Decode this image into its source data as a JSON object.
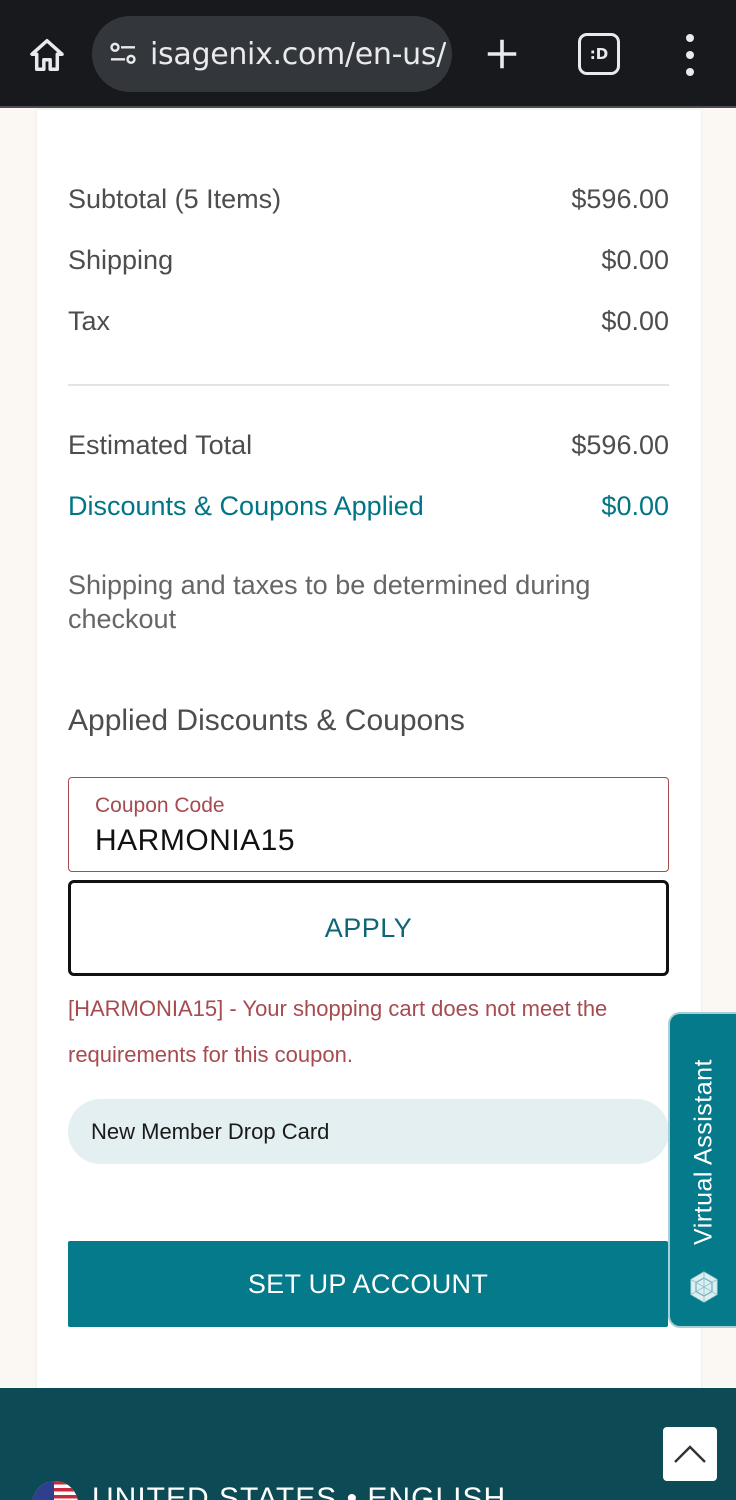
{
  "browser": {
    "url": "isagenix.com/en-us/",
    "tab_switcher_label": ":D",
    "icons": {
      "home": "home-icon",
      "site_info": "tune-icon",
      "new_tab": "plus-icon",
      "menu": "more-vert-icon"
    }
  },
  "summary": {
    "subtotal_label": "Subtotal (5 Items)",
    "subtotal_value": "$596.00",
    "shipping_label": "Shipping",
    "shipping_value": "$0.00",
    "tax_label": "Tax",
    "tax_value": "$0.00",
    "estimated_total_label": "Estimated Total",
    "estimated_total_value": "$596.00",
    "discounts_label": "Discounts & Coupons Applied",
    "discounts_value": "$0.00",
    "note": "Shipping and taxes to be determined during checkout"
  },
  "coupons": {
    "heading": "Applied Discounts & Coupons",
    "field_label": "Coupon Code",
    "field_value": "HARMONIA15",
    "apply_label": "APPLY",
    "error_message": "[HARMONIA15] - Your shopping cart does not meet the requirements for this coupon.",
    "chip_label": "New Member Drop Card"
  },
  "actions": {
    "setup_account_label": "SET UP ACCOUNT"
  },
  "assistant": {
    "label": "Virtual Assistant",
    "icon": "assistant-logo-icon"
  },
  "footer": {
    "region_label": "UNITED STATES • ENGLISH",
    "flag_icon": "us-flag-icon",
    "back_to_top_icon": "chevron-up-icon"
  },
  "colors": {
    "accent_teal": "#047a8b",
    "discount_teal": "#007585",
    "error_red": "#a64b50",
    "footer_bg": "#0c4a55",
    "chip_bg": "#e3eff1",
    "browser_bar": "#17191c"
  }
}
